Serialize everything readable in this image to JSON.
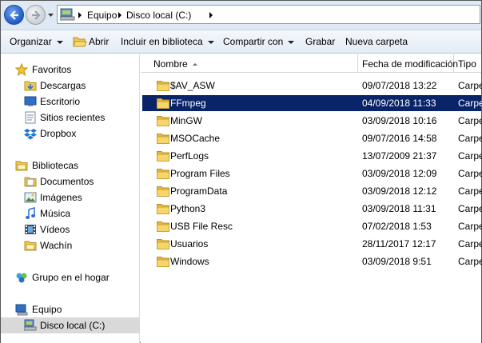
{
  "address_bar": {
    "breadcrumbs": [
      "Equipo",
      "Disco local (C:)"
    ]
  },
  "toolbar": {
    "organize": "Organizar",
    "open": "Abrir",
    "include": "Incluir en biblioteca",
    "share": "Compartir con",
    "burn": "Grabar",
    "new_folder": "Nueva carpeta"
  },
  "navpane": {
    "favorites": {
      "header": "Favoritos",
      "items": [
        "Descargas",
        "Escritorio",
        "Sitios recientes",
        "Dropbox"
      ]
    },
    "libraries": {
      "header": "Bibliotecas",
      "items": [
        "Documentos",
        "Imágenes",
        "Música",
        "Vídeos",
        "Wachín"
      ]
    },
    "homegroup": "Grupo en el hogar",
    "computer": {
      "header": "Equipo",
      "items": [
        "Disco local (C:)"
      ]
    }
  },
  "columns": {
    "name": "Nombre",
    "date": "Fecha de modificación",
    "type": "Tipo"
  },
  "files": [
    {
      "name": "$AV_ASW",
      "date": "09/07/2018 13:22",
      "type": "Carpe"
    },
    {
      "name": "FFmpeg",
      "date": "04/09/2018 11:33",
      "type": "Carpe"
    },
    {
      "name": "MinGW",
      "date": "03/09/2018 10:16",
      "type": "Carpe"
    },
    {
      "name": "MSOCache",
      "date": "09/07/2016 14:58",
      "type": "Carpe"
    },
    {
      "name": "PerfLogs",
      "date": "13/07/2009 21:37",
      "type": "Carpe"
    },
    {
      "name": "Program Files",
      "date": "03/09/2018 12:09",
      "type": "Carpe"
    },
    {
      "name": "ProgramData",
      "date": "03/09/2018 12:12",
      "type": "Carpe"
    },
    {
      "name": "Python3",
      "date": "03/09/2018 11:31",
      "type": "Carpe"
    },
    {
      "name": "USB File Resc",
      "date": "07/02/2018 1:53",
      "type": "Carpe"
    },
    {
      "name": "Usuarios",
      "date": "28/11/2017 12:17",
      "type": "Carpe"
    },
    {
      "name": "Windows",
      "date": "03/09/2018 9:51",
      "type": "Carpe"
    }
  ],
  "colors": {
    "selection": "#0a246a",
    "nav_selected": "#d9d9d9",
    "folder": "#f0c94a"
  }
}
